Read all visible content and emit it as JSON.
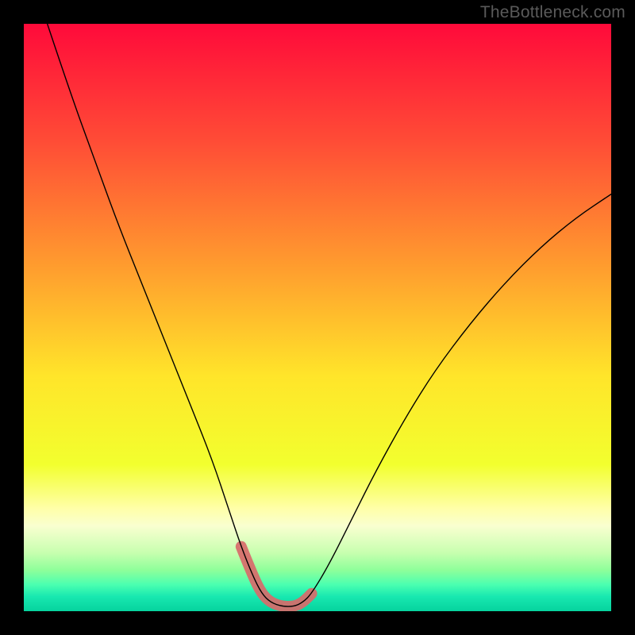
{
  "watermark": "TheBottleneck.com",
  "chart_data": {
    "type": "line",
    "title": "",
    "xlabel": "",
    "ylabel": "",
    "xlim": [
      0,
      100
    ],
    "ylim": [
      0,
      100
    ],
    "background": {
      "type": "vertical-gradient",
      "stops": [
        {
          "pos": 0.0,
          "color": "#ff0a3a"
        },
        {
          "pos": 0.2,
          "color": "#ff4c36"
        },
        {
          "pos": 0.42,
          "color": "#ff9f2e"
        },
        {
          "pos": 0.6,
          "color": "#ffe52a"
        },
        {
          "pos": 0.75,
          "color": "#f2ff2e"
        },
        {
          "pos": 0.825,
          "color": "#ffffa8"
        },
        {
          "pos": 0.855,
          "color": "#f9ffd0"
        },
        {
          "pos": 0.9,
          "color": "#c8ffb0"
        },
        {
          "pos": 0.93,
          "color": "#8eff9a"
        },
        {
          "pos": 0.955,
          "color": "#4affb0"
        },
        {
          "pos": 0.975,
          "color": "#18e8b0"
        },
        {
          "pos": 1.0,
          "color": "#06d39e"
        }
      ]
    },
    "series": [
      {
        "name": "bottleneck-curve",
        "stroke": "#000000",
        "stroke_width": 1.4,
        "x": [
          4,
          8,
          12,
          16,
          20,
          24,
          28,
          32,
          35,
          37,
          39,
          40.5,
          42,
          44,
          46,
          47.5,
          49,
          52,
          56,
          60,
          65,
          70,
          76,
          82,
          88,
          94,
          100
        ],
        "y": [
          100,
          88,
          77,
          66,
          56,
          46,
          36,
          26,
          17,
          11,
          6,
          3,
          1.5,
          0.8,
          0.8,
          1.5,
          3,
          8,
          16,
          24,
          33,
          41,
          49,
          56,
          62,
          67,
          71
        ]
      }
    ],
    "highlight": {
      "name": "optimal-range",
      "stroke": "#d86a6a",
      "stroke_width": 14,
      "linecap": "round",
      "x": [
        37,
        39,
        40.5,
        42,
        44,
        46,
        47.5,
        49
      ],
      "y": [
        11,
        6,
        3,
        1.5,
        0.8,
        0.8,
        1.5,
        3
      ]
    }
  }
}
